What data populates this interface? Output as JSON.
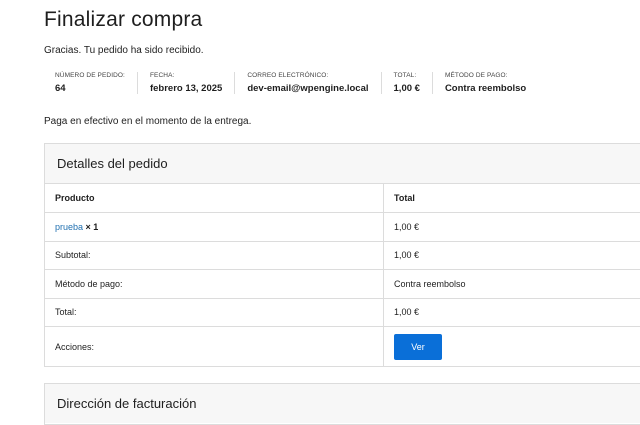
{
  "page": {
    "title": "Finalizar compra",
    "received_message": "Gracias. Tu pedido ha sido recibido.",
    "payment_note": "Paga en efectivo en el momento de la entrega."
  },
  "overview": {
    "order_number_label": "NÚMERO DE PEDIDO:",
    "order_number": "64",
    "date_label": "FECHA:",
    "date": "febrero 13, 2025",
    "email_label": "CORREO ELECTRÓNICO:",
    "email": "dev-email@wpengine.local",
    "total_label": "TOTAL:",
    "total": "1,00 €",
    "payment_method_label": "MÉTODO DE PAGO:",
    "payment_method": "Contra reembolso"
  },
  "order_details": {
    "heading": "Detalles del pedido",
    "col_product": "Producto",
    "col_total": "Total",
    "product_name": "prueba",
    "product_qty": "× 1",
    "product_total": "1,00 €",
    "subtotal_label": "Subtotal:",
    "subtotal": "1,00 €",
    "payment_method_label": "Método de pago:",
    "payment_method": "Contra reembolso",
    "total_label": "Total:",
    "total": "1,00 €",
    "actions_label": "Acciones:",
    "view_button": "Ver"
  },
  "billing": {
    "heading": "Dirección de facturación"
  },
  "colors": {
    "link": "#2271b1",
    "button": "#0a6fd8",
    "border": "#dcdcdc",
    "header_bg": "#f7f7f7"
  }
}
